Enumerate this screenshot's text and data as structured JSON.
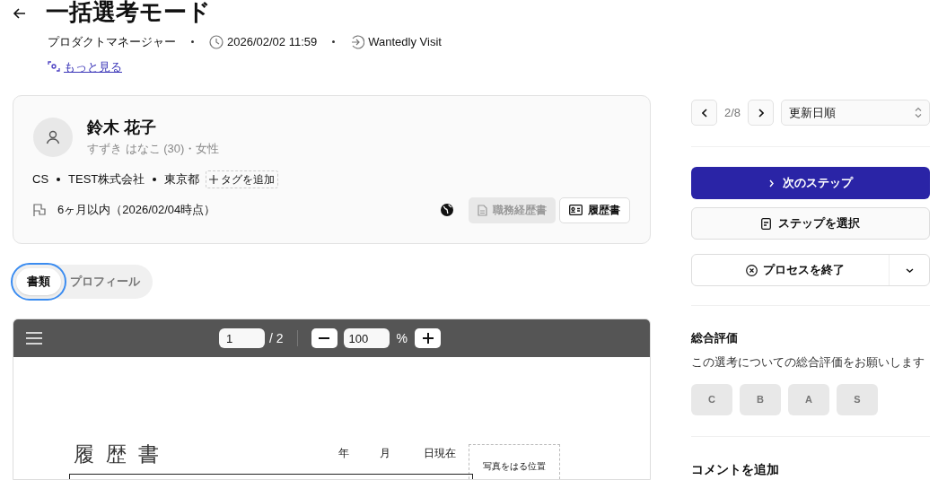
{
  "header": {
    "title": "一括選考モード",
    "job": "プロダクトマネージャー",
    "datetime": "2026/02/02 11:59",
    "source": "Wantedly Visit",
    "more_link": "もっと見る"
  },
  "candidate": {
    "name": "鈴木 花子",
    "subtitle": "すずき はなこ (30)・女性",
    "tags": [
      "CS",
      "TEST株式会社",
      "東京都"
    ],
    "add_tag": "タグを追加",
    "availability": "6ヶ月以内（2026/02/04時点）",
    "documents": [
      {
        "label": "職務経歴書",
        "disabled": true
      },
      {
        "label": "履歴書",
        "disabled": false
      }
    ]
  },
  "tabs": [
    {
      "label": "書類",
      "selected": true
    },
    {
      "label": "プロフィール",
      "selected": false
    }
  ],
  "viewer": {
    "page": "1",
    "page_total": "/ 2",
    "zoom": "100",
    "zoom_unit": "%"
  },
  "document": {
    "title": "履歴書",
    "date_labels": [
      "年",
      "月",
      "日現在"
    ],
    "photo_label": "写真をはる位置"
  },
  "pager": {
    "position": "2/8",
    "sort": "更新日順"
  },
  "actions": {
    "next_step": "次のステップ",
    "select_step": "ステップを選択",
    "end_process": "プロセスを終了"
  },
  "rating": {
    "title": "総合評価",
    "description": "この選考についての総合評価をお願いします",
    "grades": [
      "C",
      "B",
      "A",
      "S"
    ]
  },
  "comment": {
    "title": "コメントを追加"
  }
}
